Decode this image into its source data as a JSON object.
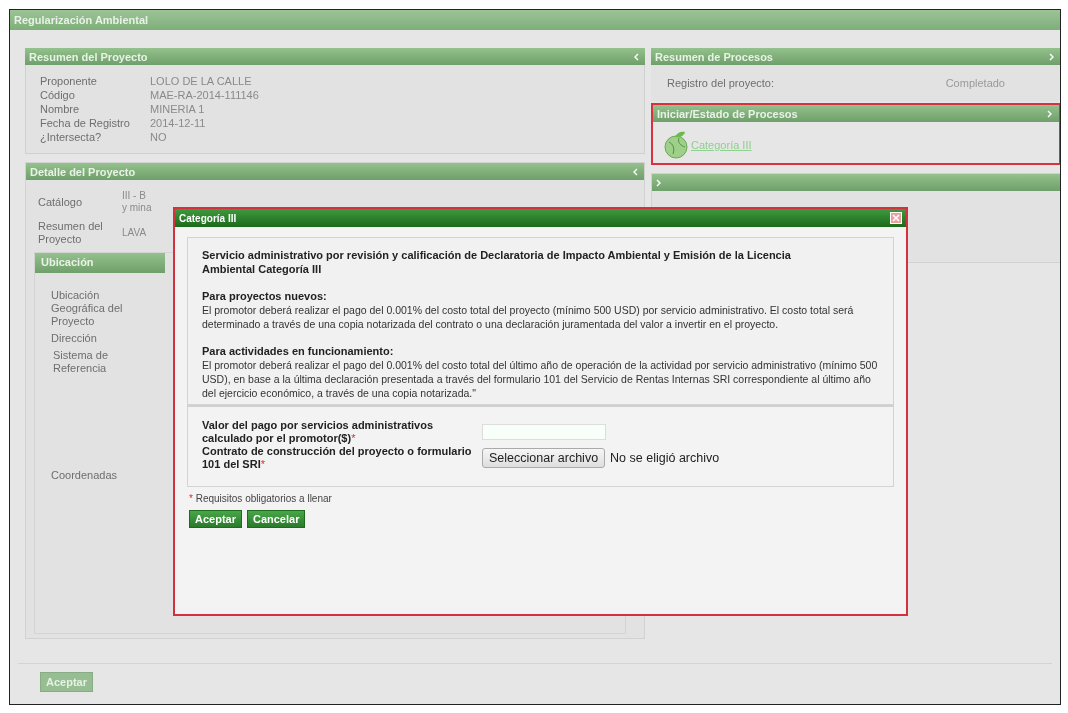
{
  "window": {
    "title": "Regularización Ambiental"
  },
  "project_summary": {
    "title": "Resumen del Proyecto",
    "fields": [
      {
        "label": "Proponente",
        "value": "LOLO DE LA CALLE"
      },
      {
        "label": "Código",
        "value": "MAE-RA-2014-111146"
      },
      {
        "label": "Nombre",
        "value": "MINERIA 1"
      },
      {
        "label": "Fecha de Registro",
        "value": "2014-12-11"
      },
      {
        "label": "¿Intersecta?",
        "value": "NO"
      }
    ]
  },
  "project_detail": {
    "title": "Detalle del Proyecto",
    "fields": [
      {
        "label": "Catálogo",
        "value_lines": [
          "III - B",
          "y mina"
        ]
      },
      {
        "label": "Resumen del Proyecto",
        "value_lines": [
          "LAVA"
        ]
      }
    ],
    "location": {
      "title": "Ubicación",
      "labels": [
        "Ubicación Geográfica del Proyecto",
        "Dirección",
        "Sistema de Referencia",
        "Coordenadas"
      ]
    }
  },
  "process_summary": {
    "title": "Resumen de Procesos",
    "rows": [
      {
        "label": "Registro del proyecto:",
        "status": "Completado"
      }
    ]
  },
  "process_start": {
    "title": "Iniciar/Estado de Procesos",
    "link": "Categoría III"
  },
  "dialog": {
    "title": "Categoría III",
    "heading": "Servicio administrativo por revisión y calificación de Declaratoria de Impacto Ambiental y Emisión de la Licencia Ambiental Categoría III",
    "sections": [
      {
        "title": "Para proyectos nuevos:",
        "text": "El promotor deberá realizar el pago del 0.001% del costo total del proyecto (mínimo 500 USD) por servicio administrativo. El costo total será determinado a través de una copia notarizada del contrato o una declaración juramentada del valor a invertir en el proyecto."
      },
      {
        "title": "Para actividades en funcionamiento:",
        "text": "El promotor deberá realizar el pago del 0.001% del costo total del último año de operación de la actividad por servicio administrativo (mínimo 500 USD), en base a la última declaración presentada a través del formulario 101 del Servicio de Rentas Internas SRI correspondiente al último año del ejercicio económico, a través de una copia notarizada.\""
      }
    ],
    "fields": [
      {
        "kind": "text",
        "label": "Valor del pago por servicios administrativos calculado por el promotor($)",
        "required_mark": "*"
      },
      {
        "kind": "file",
        "label": "Contrato de construcción del proyecto o formulario 101 del SRI",
        "required_mark": "*",
        "button": "Seleccionar archivo",
        "status": "No se eligió archivo"
      }
    ],
    "note": {
      "mark": "*",
      "text": "Requisitos obligatorios a llenar"
    },
    "buttons": [
      "Aceptar",
      "Cancelar"
    ]
  },
  "footer_button": {
    "label": "Aceptar",
    "disabled": true
  }
}
